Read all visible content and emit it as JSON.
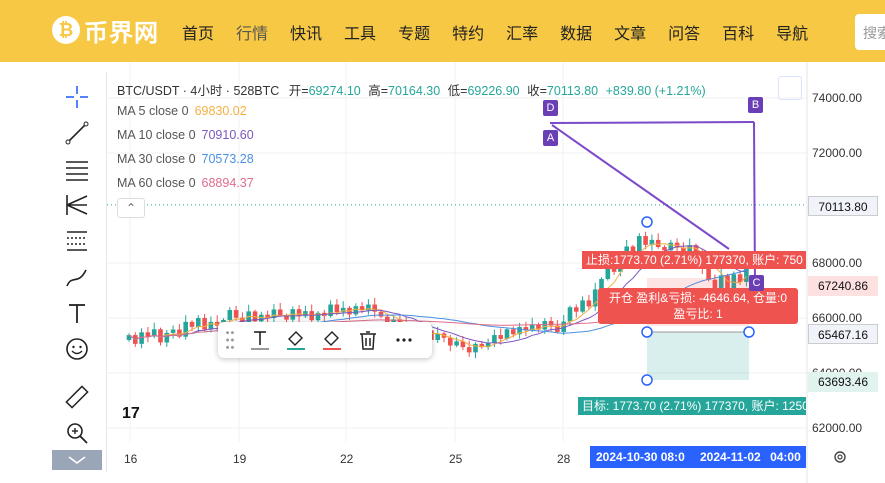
{
  "site": {
    "logo_text": "币界网",
    "nav": [
      "首页",
      "行情",
      "快讯",
      "工具",
      "专题",
      "特约",
      "汇率",
      "数据",
      "文章",
      "问答",
      "百科",
      "导航"
    ],
    "active_nav": "行情",
    "search_placeholder": "搜索"
  },
  "chart_header": {
    "symbol": "BTC/USDT · 4小时 · 528BTC",
    "open_label": "开=",
    "open": "69274.10",
    "high_label": "高=",
    "high": "70164.30",
    "low_label": "低=",
    "low": "69226.90",
    "close_label": "收=",
    "close": "70113.80",
    "change": "+839.80 (+1.21%)"
  },
  "ma_lines": [
    {
      "label": "MA 5 close 0",
      "value": "69830.02",
      "color": "#f5b041"
    },
    {
      "label": "MA 10 close 0",
      "value": "70910.60",
      "color": "#7e57c2"
    },
    {
      "label": "MA 30 close 0",
      "value": "70573.28",
      "color": "#4a90e2"
    },
    {
      "label": "MA 60 close 0",
      "value": "68894.37",
      "color": "#e06c8b"
    }
  ],
  "collapse_label": "⌃",
  "price_axis": [
    "74000.00",
    "72000.00",
    "68000.00",
    "66000.00",
    "64000.00",
    "62000.00"
  ],
  "price_tags": {
    "current": "70113.80",
    "stop": "67240.86",
    "entry": "65467.16",
    "target": "63693.46"
  },
  "x_axis": [
    "16",
    "19",
    "22",
    "25",
    "28"
  ],
  "date_tags": [
    "2024-10-30",
    "08:0",
    "2024-11-02",
    "04:00"
  ],
  "position_tool": {
    "stop_text": "止损:1773.70 (2.71%) 177370, 账户: 750",
    "pnl_line1": "开仓 盈利&亏损: -4646.64, 仓量:0",
    "pnl_line2": "盈亏比: 1",
    "target_text": "目标: 1773.70 (2.71%) 177370, 账户: 1250"
  },
  "drawing_letters": [
    "A",
    "B",
    "C",
    "D"
  ],
  "tv_logo": "17",
  "colors": {
    "up": "#26a69a",
    "down": "#ef5350",
    "nav_bg": "#f7c843",
    "drawing": "#7b49c9",
    "date_tag": "#2962ff"
  },
  "candles": {
    "start_price": 65200,
    "moves": [
      180,
      -320,
      420,
      -150,
      260,
      -480,
      350,
      120,
      -260,
      540,
      -180,
      320,
      -420,
      280,
      -140,
      210,
      360,
      -280,
      -190,
      420,
      -360,
      240,
      -120,
      310,
      -210,
      -160,
      380,
      -260,
      190,
      -330,
      270,
      -120,
      420,
      -280,
      160,
      -240,
      300,
      -150,
      210,
      -260,
      -180,
      -420,
      320,
      -150,
      -380,
      210,
      -260,
      180,
      -350,
      240,
      -160,
      -280,
      150,
      -210,
      -190,
      310,
      -120,
      160,
      280,
      -140,
      350,
      -180,
      260,
      -120,
      220,
      -190,
      310,
      -160,
      -240,
      380,
      520,
      -160,
      410,
      -220,
      620,
      380,
      460,
      -200,
      540,
      380,
      -240,
      620,
      -320,
      180,
      -260,
      -120,
      280,
      -180,
      -210,
      300,
      -260,
      -580,
      -420,
      -360,
      520,
      -620,
      660,
      -280,
      839
    ]
  }
}
